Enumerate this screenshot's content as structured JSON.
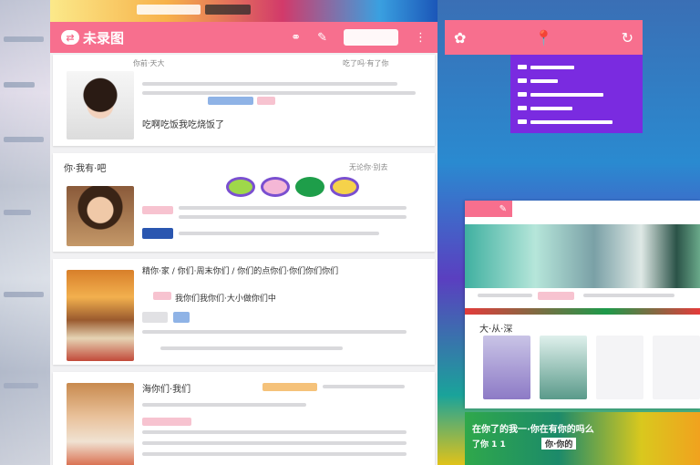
{
  "app": {
    "title": "未录图",
    "accent": "#f76f8e",
    "menu_accent": "#7a2be0"
  },
  "header": {
    "icons": [
      "swap-icon",
      "edit-icon",
      "more-icon"
    ]
  },
  "right_toolbar": {
    "icons": [
      "logo-icon",
      "pin-icon",
      "refresh-icon"
    ]
  },
  "cards": [
    {
      "meta_top": "你前·天大",
      "meta_right": "吃了吗·有了你",
      "caption": "吃啊吃饭我吃烧饭了"
    },
    {
      "title": "你·我有·吧",
      "meta_right": "无论你·别去"
    },
    {
      "title": "精你·家 / 你们·周末你们 / 你们的点你们·你们你们你们",
      "subtitle": "我你们我你们·大小做你们中"
    },
    {
      "title": "海你们·我们"
    }
  ],
  "secondary": {
    "heading": "大·从·深"
  },
  "bottom_bar": {
    "line1": "在你了的我一·你在有你的吗么",
    "line2": "了你 1 1",
    "line3": "你·你的"
  }
}
